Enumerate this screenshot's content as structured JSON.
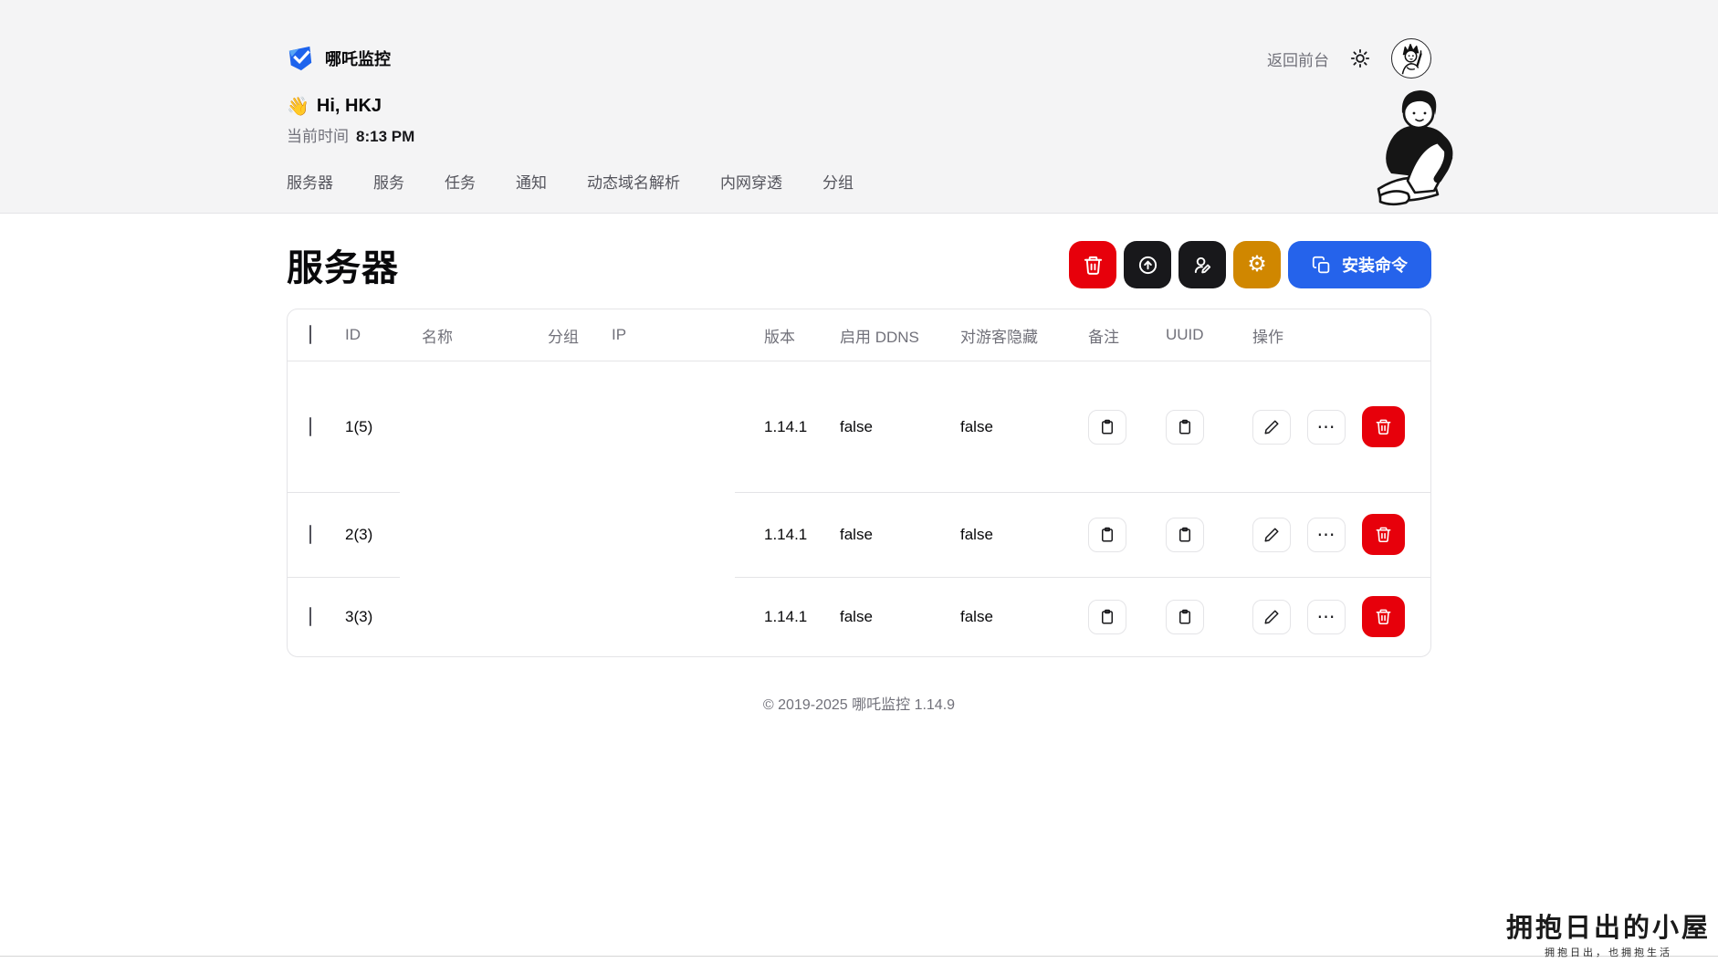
{
  "header": {
    "brand": "哪吒监控",
    "back_link": "返回前台",
    "greeting_emoji": "👋",
    "greeting": "Hi, HKJ",
    "time_label": "当前时间",
    "time_value": "8:13 PM",
    "nav": [
      "服务器",
      "服务",
      "任务",
      "通知",
      "动态域名解析",
      "内网穿透",
      "分组"
    ]
  },
  "page": {
    "title": "服务器",
    "install_button": "安装命令"
  },
  "table": {
    "columns": [
      "ID",
      "名称",
      "分组",
      "IP",
      "版本",
      "启用 DDNS",
      "对游客隐藏",
      "备注",
      "UUID",
      "操作"
    ],
    "rows": [
      {
        "id": "1(5)",
        "name": "",
        "group": "",
        "ip": "",
        "version": "1.14.1",
        "ddns": "false",
        "hidden": "false"
      },
      {
        "id": "2(3)",
        "name": "",
        "group": "",
        "ip": "",
        "version": "1.14.1",
        "ddns": "false",
        "hidden": "false"
      },
      {
        "id": "3(3)",
        "name": "",
        "group": "",
        "ip": "",
        "version": "1.14.1",
        "ddns": "false",
        "hidden": "false"
      }
    ]
  },
  "footer": {
    "copyright": "© 2019-2025 哪吒监控 1.14.9"
  },
  "watermark": {
    "title": "拥抱日出的小屋",
    "subtitle": "拥抱日出，也拥抱生活"
  },
  "icons": {
    "gear": "⚙",
    "more": "⋯"
  },
  "colors": {
    "accent_blue": "#2563eb",
    "danger_red": "#e7000b",
    "gold": "#d08700",
    "black": "#18181b",
    "header_bg": "#f4f4f5",
    "border": "#e4e4e7"
  }
}
